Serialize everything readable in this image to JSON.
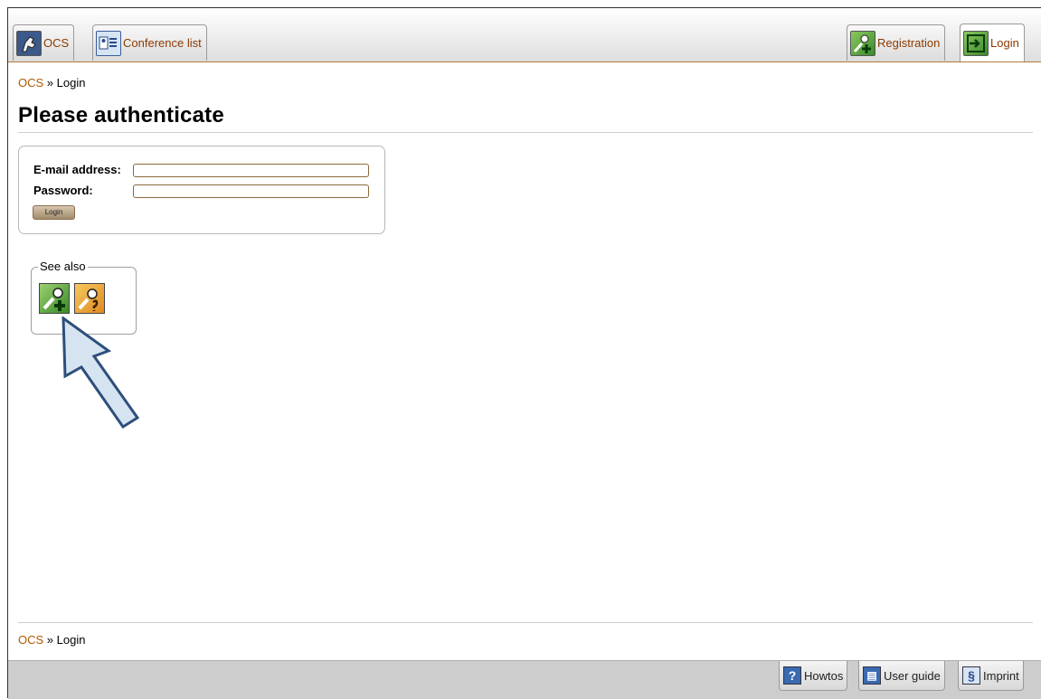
{
  "nav": {
    "left_tabs": [
      {
        "label": "OCS",
        "icon": "horse-logo-icon"
      },
      {
        "label": "Conference list",
        "icon": "contact-list-icon"
      }
    ],
    "right_tabs": [
      {
        "label": "Registration",
        "icon": "add-user-key-icon"
      },
      {
        "label": "Login",
        "icon": "login-door-icon"
      }
    ]
  },
  "breadcrumb": {
    "root": "OCS",
    "separator": "»",
    "current": "Login"
  },
  "page_title": "Please authenticate",
  "login_form": {
    "email_label": "E-mail address:",
    "email_value": "",
    "password_label": "Password:",
    "password_value": "",
    "submit_label": "Login"
  },
  "see_also": {
    "legend": "See also",
    "items": [
      {
        "icon": "register-key-icon"
      },
      {
        "icon": "forgot-password-key-icon"
      }
    ]
  },
  "footer_breadcrumb": {
    "root": "OCS",
    "separator": "»",
    "current": "Login"
  },
  "footer_tabs": [
    {
      "label": "Howtos",
      "icon": "question-mark-icon"
    },
    {
      "label": "User guide",
      "icon": "book-icon"
    },
    {
      "label": "Imprint",
      "icon": "section-sign-icon"
    }
  ],
  "colors": {
    "link": "#b05a00",
    "tab_text": "#8b3a00",
    "arrow_fill": "#d6e4f2",
    "arrow_stroke": "#2e4f7a"
  }
}
